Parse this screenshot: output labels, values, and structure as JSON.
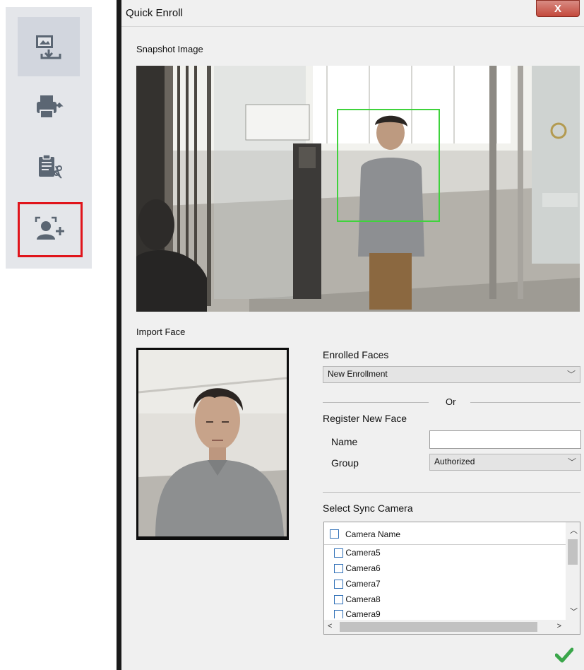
{
  "toolbar": {
    "items": [
      {
        "icon": "image-download-icon"
      },
      {
        "icon": "fax-printer-icon"
      },
      {
        "icon": "clipboard-cut-icon"
      },
      {
        "icon": "face-enroll-icon"
      }
    ]
  },
  "dialog": {
    "title": "Quick Enroll",
    "close_label": "X",
    "snapshot_label": "Snapshot Image",
    "import_face_label": "Import Face",
    "enrolled_faces_label": "Enrolled Faces",
    "enrolled_faces_value": "New Enrollment",
    "or_label": "Or",
    "register_label": "Register New Face",
    "name_label": "Name",
    "name_value": "",
    "group_label": "Group",
    "group_value": "Authorized",
    "sync_camera_label": "Select Sync Camera",
    "camera_header": "Camera Name",
    "cameras": [
      "Camera5",
      "Camera6",
      "Camera7",
      "Camera8",
      "Camera9"
    ],
    "confirm_icon": "checkmark-icon"
  },
  "colors": {
    "highlight": "#e0141b",
    "face_box": "#3fd33c",
    "confirm": "#3aa64a"
  }
}
